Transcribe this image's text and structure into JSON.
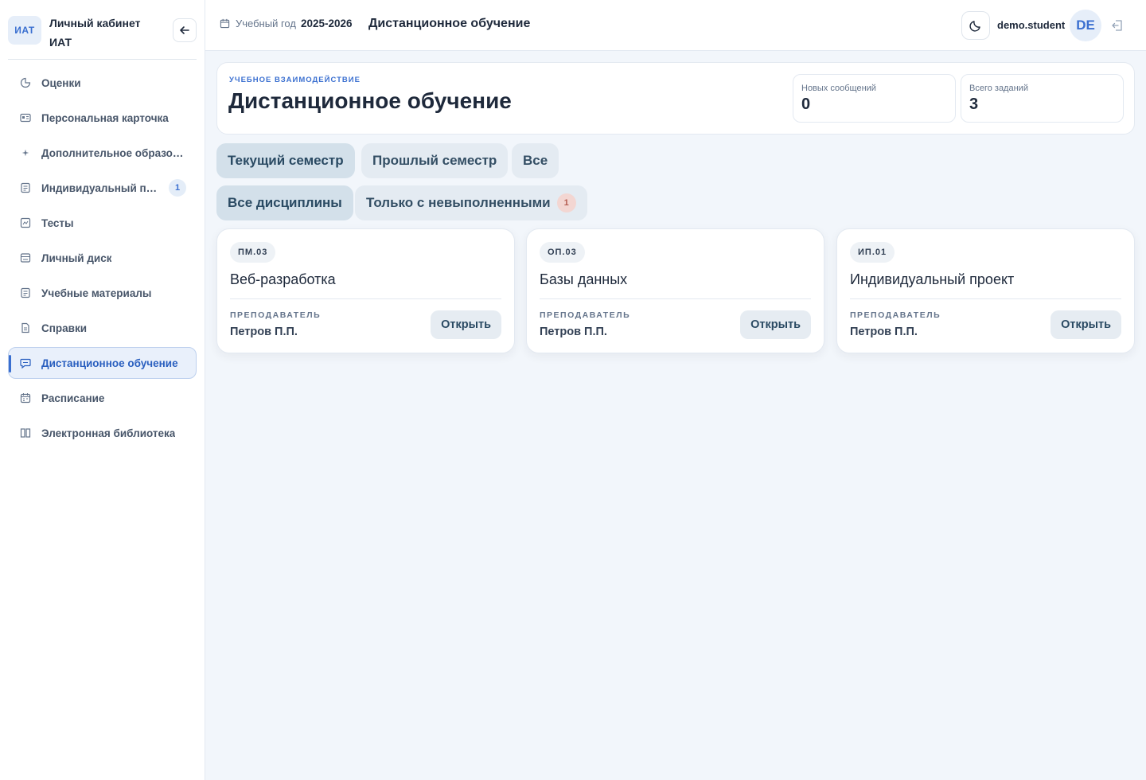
{
  "brand": {
    "logo": "ИАТ",
    "title": "Личный кабинет ИАТ"
  },
  "sidebar": {
    "items": [
      {
        "label": "Оценки",
        "icon": "grades-icon"
      },
      {
        "label": "Персональная карточка",
        "icon": "id-card-icon"
      },
      {
        "label": "Дополнительное образов...",
        "icon": "sparkle-icon"
      },
      {
        "label": "Индивидуальный пр...",
        "icon": "document-icon",
        "badge": "1"
      },
      {
        "label": "Тесты",
        "icon": "test-icon"
      },
      {
        "label": "Личный диск",
        "icon": "disk-icon"
      },
      {
        "label": "Учебные материалы",
        "icon": "materials-icon"
      },
      {
        "label": "Справки",
        "icon": "certificate-icon"
      },
      {
        "label": "Дистанционное обучение",
        "icon": "chat-icon",
        "active": true
      },
      {
        "label": "Расписание",
        "icon": "calendar-icon"
      },
      {
        "label": "Электронная библиотека",
        "icon": "library-icon"
      }
    ]
  },
  "topbar": {
    "year_label": "Учебный год",
    "year_value": "2025-2026",
    "title": "Дистанционное обучение",
    "username": "demo.student",
    "avatar": "DE"
  },
  "header": {
    "eyebrow": "УЧЕБНОЕ ВЗАИМОДЕЙСТВИЕ",
    "title": "Дистанционное обучение",
    "stats": [
      {
        "label": "Новых сообщений",
        "value": "0"
      },
      {
        "label": "Всего заданий",
        "value": "3"
      }
    ]
  },
  "filters": {
    "semester": [
      "Текущий семестр",
      "Прошлый семестр",
      "Все"
    ],
    "disciplines": [
      "Все дисциплины",
      "Только с невыполненными"
    ],
    "pending_count": "1"
  },
  "courses": [
    {
      "code": "ПМ.03",
      "name": "Веб-разработка",
      "teacher_label": "ПРЕПОДАВАТЕЛЬ",
      "teacher": "Петров П.П.",
      "action": "Открыть"
    },
    {
      "code": "ОП.03",
      "name": "Базы данных",
      "teacher_label": "ПРЕПОДАВАТЕЛЬ",
      "teacher": "Петров П.П.",
      "action": "Открыть"
    },
    {
      "code": "ИП.01",
      "name": "Индивидуальный проект",
      "teacher_label": "ПРЕПОДАВАТЕЛЬ",
      "teacher": "Петров П.П.",
      "action": "Открыть"
    }
  ],
  "colors": {
    "accent": "#3a6fd0",
    "badge_alert": "#f3d6d2"
  }
}
